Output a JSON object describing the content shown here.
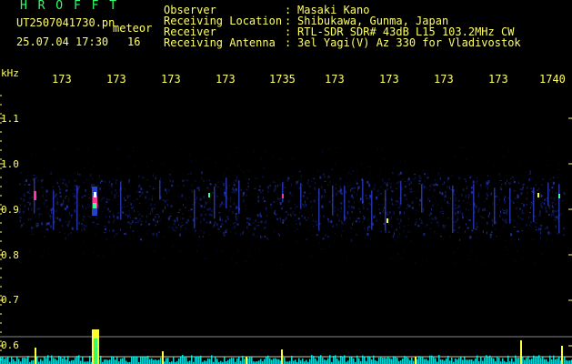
{
  "header": {
    "logo": "H R O F F T",
    "filename": "UT2507041730.pn",
    "kind": "meteor",
    "datetime": "25.07.04 17:30",
    "count": "16",
    "info_labels": [
      "Observer",
      "Receiving Location",
      "Receiver",
      "Receiving Antenna"
    ],
    "info_sep": ":",
    "info_values": [
      "Masaki Kano",
      "Shibukawa, Gunma, Japan",
      "RTL-SDR SDR# 43dB L15 103.2MHz CW",
      "3el Yagi(V) Az 330 for Vladivostok"
    ]
  },
  "axes": {
    "y_unit": "kHz",
    "y_ticks": [
      "1.1",
      "1.0",
      "0.9",
      "0.8",
      "0.7",
      "0.6"
    ],
    "x_ticks": [
      "173",
      "173",
      "173",
      "173",
      "1735",
      "173",
      "173",
      "173",
      "173",
      "1740"
    ]
  },
  "colors": {
    "background": "#000000",
    "text_yellow": "#ffff66",
    "text_green": "#33ff66",
    "trace_blue": "#2233aa",
    "meteor_magenta": "#ff3399",
    "meteor_yellow": "#ffff33",
    "level_cyan": "#00ffff"
  }
}
